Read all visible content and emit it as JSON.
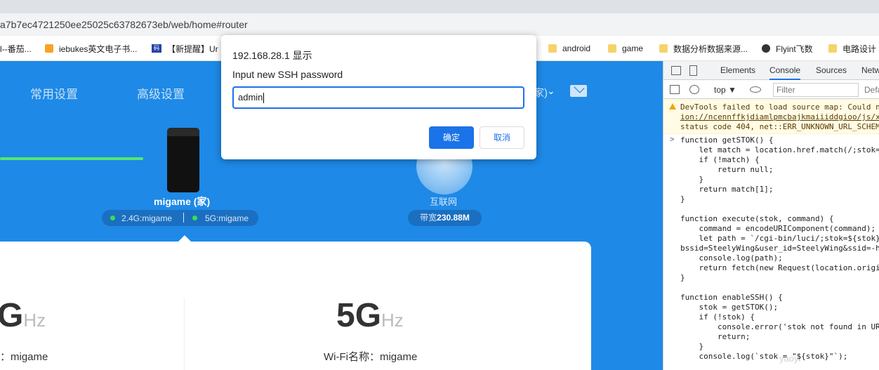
{
  "browser": {
    "url": "a7b7ec4721250ee25025c63782673eb/web/home#router",
    "bookmarks": [
      {
        "label": "l--番茄...",
        "icon": "bookmark-icon"
      },
      {
        "label": "iebukes英文电子书...",
        "icon": "bookmark-favicon-icon"
      },
      {
        "label": "【新提醒】Ur",
        "icon": "bookmark-favicon-icon"
      },
      {
        "label": "android",
        "icon": "folder-icon"
      },
      {
        "label": "game",
        "icon": "folder-icon"
      },
      {
        "label": "数据分析数据来源...",
        "icon": "folder-icon"
      },
      {
        "label": "Flyint飞数",
        "icon": "globe-icon"
      },
      {
        "label": "电路设计",
        "icon": "folder-icon"
      }
    ],
    "bookmark_ri_icon": "码"
  },
  "page": {
    "nav": [
      "常用设置",
      "高级设置"
    ],
    "nav_paren": "家)",
    "router_name": "migame (家)",
    "ssid_24": "2.4G:migame",
    "ssid_5": "5G:migame",
    "internet_label": "互联网",
    "bandwidth_prefix": "带宽",
    "bandwidth_value": "230.88M",
    "band_left": {
      "big": "G",
      "unit": "Hz",
      "wifi": "：migame"
    },
    "band_right": {
      "big": "5G",
      "unit": "Hz",
      "wifi": "Wi-Fi名称：migame"
    }
  },
  "dialog": {
    "title": "192.168.28.1 显示",
    "message": "Input new SSH password",
    "input_value": "admin",
    "ok_label": "确定",
    "cancel_label": "取消"
  },
  "devtools": {
    "tabs": [
      "Elements",
      "Console",
      "Sources",
      "Netw"
    ],
    "context": "top ▼",
    "filter_placeholder": "Filter",
    "default_levels": "Defa",
    "warning": [
      "DevTools failed to load source map: Could n",
      "ion://ncennffkjdiamlpmcbajkmaiiiddgioo/js/x",
      "status code 404, net::ERR_UNKNOWN_URL_SCHEM"
    ],
    "code": [
      "function getSTOK() {",
      "    let match = location.href.match(/;stok=",
      "    if (!match) {",
      "        return null;",
      "    }",
      "    return match[1];",
      "}",
      "",
      "function execute(stok, command) {",
      "    command = encodeURIComponent(command);",
      "    let path = `/cgi-bin/luci/;stok=${stok}",
      "bssid=SteelyWing&user_id=SteelyWing&ssid=-h",
      "    console.log(path);",
      "    return fetch(new Request(location.origi",
      "}",
      "",
      "function enableSSH() {",
      "    stok = getSTOK();",
      "    if (!stok) {",
      "        console.error('stok not found in UR",
      "        return;",
      "    }",
      "    console.log(`stok = \"${stok}\"`);"
    ],
    "watermark": "yaoyi"
  },
  "colors": {
    "page_blue": "#1e89e6",
    "accent": "#1a73e8",
    "green_status": "#34e053"
  }
}
